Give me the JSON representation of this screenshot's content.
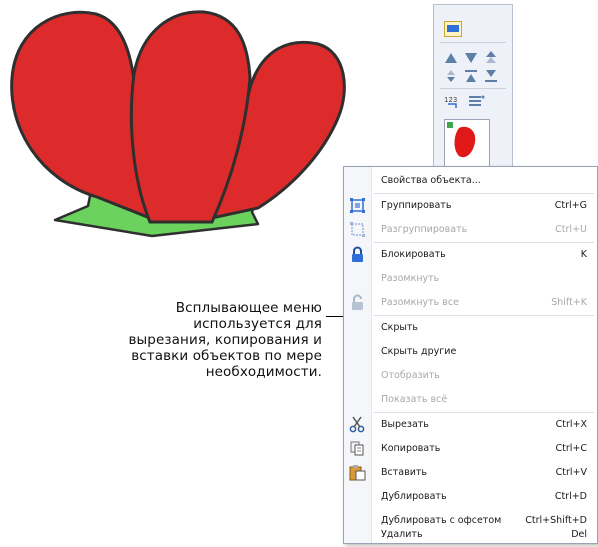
{
  "callout": {
    "text": "Всплывающее меню\nиспользуется для\nвырезания, копирования и\nвставки объектов по мере\nнеобходимости."
  },
  "toolbar": {
    "buttons": [
      "view-icon",
      "bring-forward-icon",
      "send-backward-icon",
      "bring-to-front-icon",
      "move-down-icon",
      "move-up-icon",
      "send-to-back-icon",
      "sequence-icon",
      "color-bars-icon"
    ]
  },
  "context_menu": {
    "items": [
      {
        "label": "Свойства объекта...",
        "shortcut": "",
        "enabled": true,
        "icon": ""
      },
      {
        "label": "Группировать",
        "shortcut": "Ctrl+G",
        "enabled": true,
        "icon": "group-icon"
      },
      {
        "label": "Разгруппировать",
        "shortcut": "Ctrl+U",
        "enabled": false,
        "icon": "ungroup-icon"
      },
      {
        "label": "Блокировать",
        "shortcut": "K",
        "enabled": true,
        "icon": "lock-icon"
      },
      {
        "label": "Разомкнуть",
        "shortcut": "",
        "enabled": false,
        "icon": ""
      },
      {
        "label": "Разомкнуть все",
        "shortcut": "Shift+K",
        "enabled": false,
        "icon": "unlock-icon"
      },
      {
        "label": "Скрыть",
        "shortcut": "",
        "enabled": true,
        "icon": ""
      },
      {
        "label": "Скрыть другие",
        "shortcut": "",
        "enabled": true,
        "icon": ""
      },
      {
        "label": "Отобразить",
        "shortcut": "",
        "enabled": false,
        "icon": ""
      },
      {
        "label": "Показать всё",
        "shortcut": "",
        "enabled": false,
        "icon": ""
      },
      {
        "label": "Вырезать",
        "shortcut": "Ctrl+X",
        "enabled": true,
        "icon": "scissors-icon"
      },
      {
        "label": "Копировать",
        "shortcut": "Ctrl+C",
        "enabled": true,
        "icon": "copy-icon"
      },
      {
        "label": "Вставить",
        "shortcut": "Ctrl+V",
        "enabled": true,
        "icon": "paste-icon"
      },
      {
        "label": "Дублировать",
        "shortcut": "Ctrl+D",
        "enabled": true,
        "icon": ""
      },
      {
        "label": "Дублировать с офсетом",
        "shortcut": "Ctrl+Shift+D",
        "enabled": true,
        "icon": ""
      },
      {
        "label": "Удалить",
        "shortcut": "Del",
        "enabled": true,
        "icon": ""
      }
    ]
  },
  "colors": {
    "petal_fill": "#dd2a2a",
    "petal_outline": "#3a3a3a",
    "leaf_fill": "#6bd25e",
    "toolbar_accent": "#2f6fd6"
  }
}
